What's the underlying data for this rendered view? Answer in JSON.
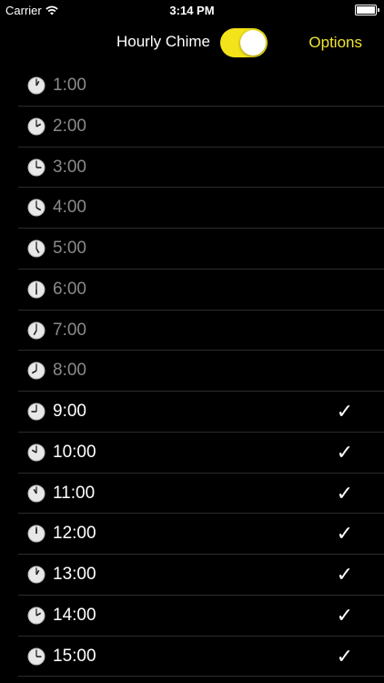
{
  "status_bar": {
    "carrier": "Carrier",
    "time": "3:14 PM"
  },
  "nav": {
    "title": "Hourly Chime",
    "toggle_on": true,
    "options_label": "Options"
  },
  "colors": {
    "accent": "#f3e31a",
    "options_text": "#f2e534",
    "background": "#000000",
    "inactive_text": "#8a8a8a"
  },
  "hours": [
    {
      "label": "1:00",
      "checked": false,
      "h": 1
    },
    {
      "label": "2:00",
      "checked": false,
      "h": 2
    },
    {
      "label": "3:00",
      "checked": false,
      "h": 3
    },
    {
      "label": "4:00",
      "checked": false,
      "h": 4
    },
    {
      "label": "5:00",
      "checked": false,
      "h": 5
    },
    {
      "label": "6:00",
      "checked": false,
      "h": 6
    },
    {
      "label": "7:00",
      "checked": false,
      "h": 7
    },
    {
      "label": "8:00",
      "checked": false,
      "h": 8
    },
    {
      "label": "9:00",
      "checked": true,
      "h": 9
    },
    {
      "label": "10:00",
      "checked": true,
      "h": 10
    },
    {
      "label": "11:00",
      "checked": true,
      "h": 11
    },
    {
      "label": "12:00",
      "checked": true,
      "h": 12
    },
    {
      "label": "13:00",
      "checked": true,
      "h": 1
    },
    {
      "label": "14:00",
      "checked": true,
      "h": 2
    },
    {
      "label": "15:00",
      "checked": true,
      "h": 3
    }
  ],
  "check_glyph": "✓"
}
